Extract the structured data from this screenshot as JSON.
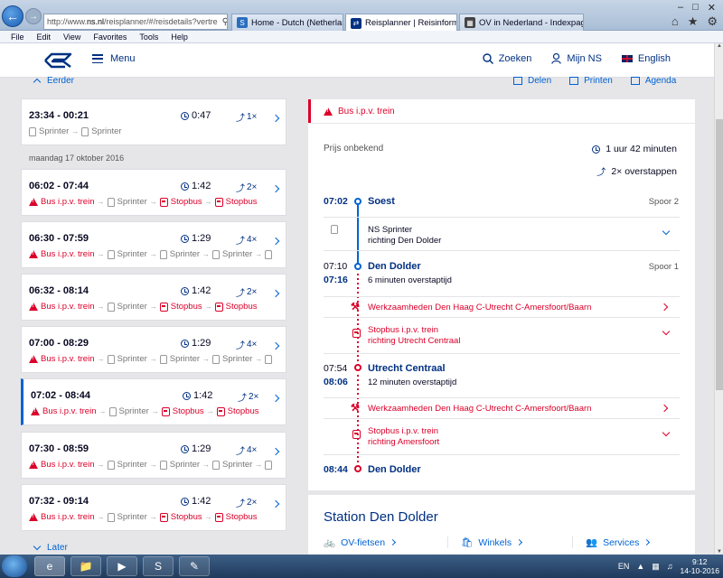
{
  "browser": {
    "url_prefix": "http://www.",
    "url_host": "ns.nl",
    "url_path": "/reisplanner/#/reisdetails?vertre",
    "tabs": [
      {
        "label": "Home - Dutch (Netherlands)"
      },
      {
        "label": "Reisplanner | Reisinformatie..."
      },
      {
        "label": "OV in Nederland - Indexpagina"
      }
    ],
    "menu": [
      "File",
      "Edit",
      "View",
      "Favorites",
      "Tools",
      "Help"
    ]
  },
  "header": {
    "menu_label": "Menu",
    "search_label": "Zoeken",
    "account_label": "Mijn NS",
    "language_label": "English"
  },
  "list": {
    "earlier_label": "Eerder",
    "later_label": "Later",
    "date_label": "maandag 17 oktober 2016",
    "trips": [
      {
        "time": "23:34 - 00:21",
        "duration": "0:47",
        "transfers": "1×",
        "legs": [
          "Sprinter",
          "Sprinter"
        ]
      },
      {
        "time": "06:02 - 07:44",
        "duration": "1:42",
        "transfers": "2×",
        "legs": [
          "Bus i.p.v. trein",
          "Sprinter",
          "Stopbus",
          "Stopbus"
        ]
      },
      {
        "time": "06:30 - 07:59",
        "duration": "1:29",
        "transfers": "4×",
        "legs": [
          "Bus i.p.v. trein",
          "Sprinter",
          "Sprinter",
          "Sprinter",
          "Sp"
        ]
      },
      {
        "time": "06:32 - 08:14",
        "duration": "1:42",
        "transfers": "2×",
        "legs": [
          "Bus i.p.v. trein",
          "Sprinter",
          "Stopbus",
          "Stopbus"
        ]
      },
      {
        "time": "07:00 - 08:29",
        "duration": "1:29",
        "transfers": "4×",
        "legs": [
          "Bus i.p.v. trein",
          "Sprinter",
          "Sprinter",
          "Sprinter",
          "Sp"
        ]
      },
      {
        "time": "07:02 - 08:44",
        "duration": "1:42",
        "transfers": "2×",
        "legs": [
          "Bus i.p.v. trein",
          "Sprinter",
          "Stopbus",
          "Stopbus"
        ]
      },
      {
        "time": "07:30 - 08:59",
        "duration": "1:29",
        "transfers": "4×",
        "legs": [
          "Bus i.p.v. trein",
          "Sprinter",
          "Sprinter",
          "Sprinter",
          "Sp"
        ]
      },
      {
        "time": "07:32 - 09:14",
        "duration": "1:42",
        "transfers": "2×",
        "legs": [
          "Bus i.p.v. trein",
          "Sprinter",
          "Stopbus",
          "Stopbus"
        ]
      }
    ]
  },
  "detail": {
    "actions": {
      "share": "Delen",
      "print": "Printen",
      "calendar": "Agenda"
    },
    "notice": "Bus i.p.v. trein",
    "price": "Prijs onbekend",
    "total_duration": "1 uur 42 minuten",
    "total_transfers": "2× overstappen",
    "stops": {
      "soest": {
        "time": "07:02",
        "name": "Soest",
        "platform": "Spoor 2"
      },
      "dendolder": {
        "arr": "07:10",
        "dep": "07:16",
        "name": "Den Dolder",
        "platform": "Spoor 1",
        "transfer": "6 minuten overstaptijd"
      },
      "utrecht": {
        "arr": "07:54",
        "dep": "08:06",
        "name": "Utrecht Centraal",
        "transfer": "12 minuten overstaptijd"
      },
      "end": {
        "time": "08:44",
        "name": "Den Dolder"
      }
    },
    "legs": {
      "train": {
        "line1": "NS Sprinter",
        "line2": "richting Den Dolder"
      },
      "works1": "Werkzaamheden Den Haag C-Utrecht C-Amersfoort/Baarn",
      "bus1": {
        "line1": "Stopbus i.p.v. trein",
        "line2": "richting Utrecht Centraal"
      },
      "works2": "Werkzaamheden Den Haag C-Utrecht C-Amersfoort/Baarn",
      "bus2": {
        "line1": "Stopbus i.p.v. trein",
        "line2": "richting Amersfoort"
      }
    }
  },
  "station": {
    "title": "Station Den Dolder",
    "links": [
      "OV-fietsen",
      "Winkels",
      "Services"
    ]
  },
  "taskbar": {
    "lang": "EN",
    "time": "9:12",
    "date": "14-10-2016"
  },
  "colors": {
    "ns_blue": "#003082",
    "link_blue": "#0063d3",
    "alert_red": "#db0029"
  }
}
